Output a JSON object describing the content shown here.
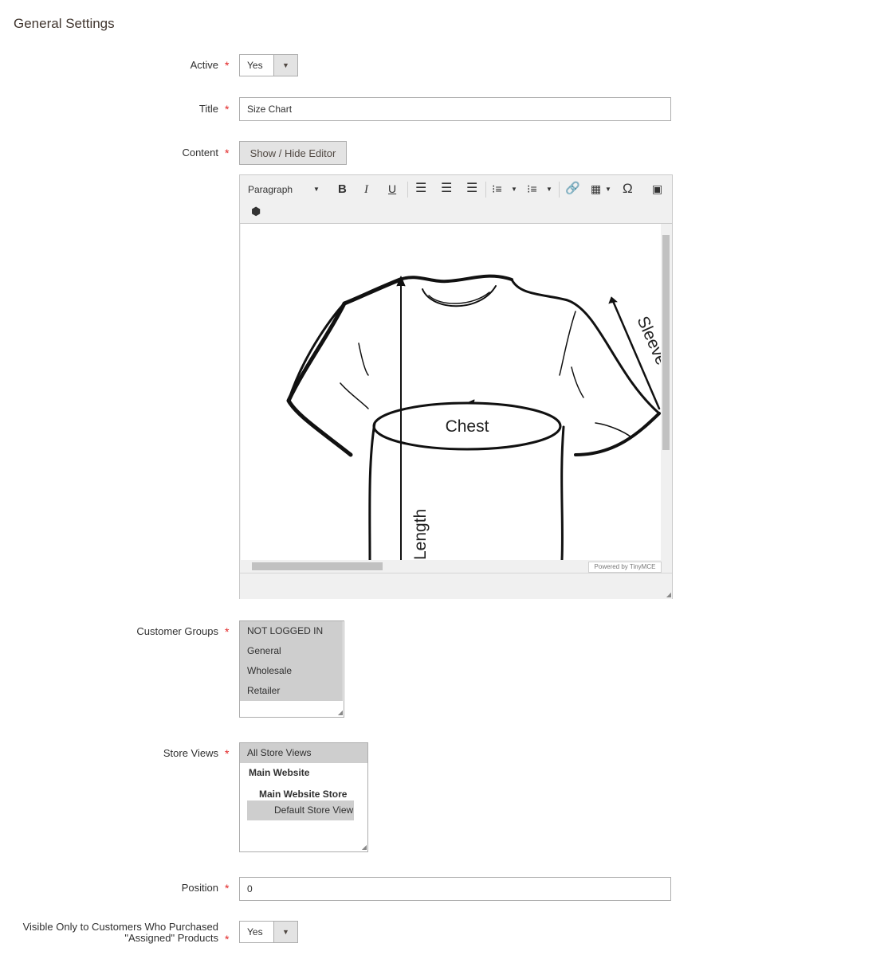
{
  "section": {
    "title": "General Settings"
  },
  "required_mark": "*",
  "fields": {
    "active": {
      "label": "Active",
      "value": "Yes"
    },
    "title": {
      "label": "Title",
      "value": "Size Chart"
    },
    "content": {
      "label": "Content",
      "toggle_button": "Show / Hide Editor"
    },
    "customer_groups": {
      "label": "Customer Groups",
      "options": [
        "NOT LOGGED IN",
        "General",
        "Wholesale",
        "Retailer"
      ],
      "selected": [
        "NOT LOGGED IN",
        "General",
        "Wholesale",
        "Retailer"
      ]
    },
    "store_views": {
      "label": "Store Views",
      "options": [
        "All Store Views",
        "Main Website",
        "Main Website Store",
        "Default Store View"
      ],
      "selected": [
        "All Store Views",
        "Default Store View"
      ]
    },
    "position": {
      "label": "Position",
      "value": "0"
    },
    "visible_only": {
      "label_line1": "Visible Only to Customers Who Purchased",
      "label_line2": "\"Assigned\" Products",
      "value": "Yes"
    }
  },
  "editor": {
    "format_select": "Paragraph",
    "powered_by": "Powered by TinyMCE",
    "image_labels": {
      "chest": "Chest",
      "length": "Length",
      "sleeve": "Sleeve"
    }
  }
}
